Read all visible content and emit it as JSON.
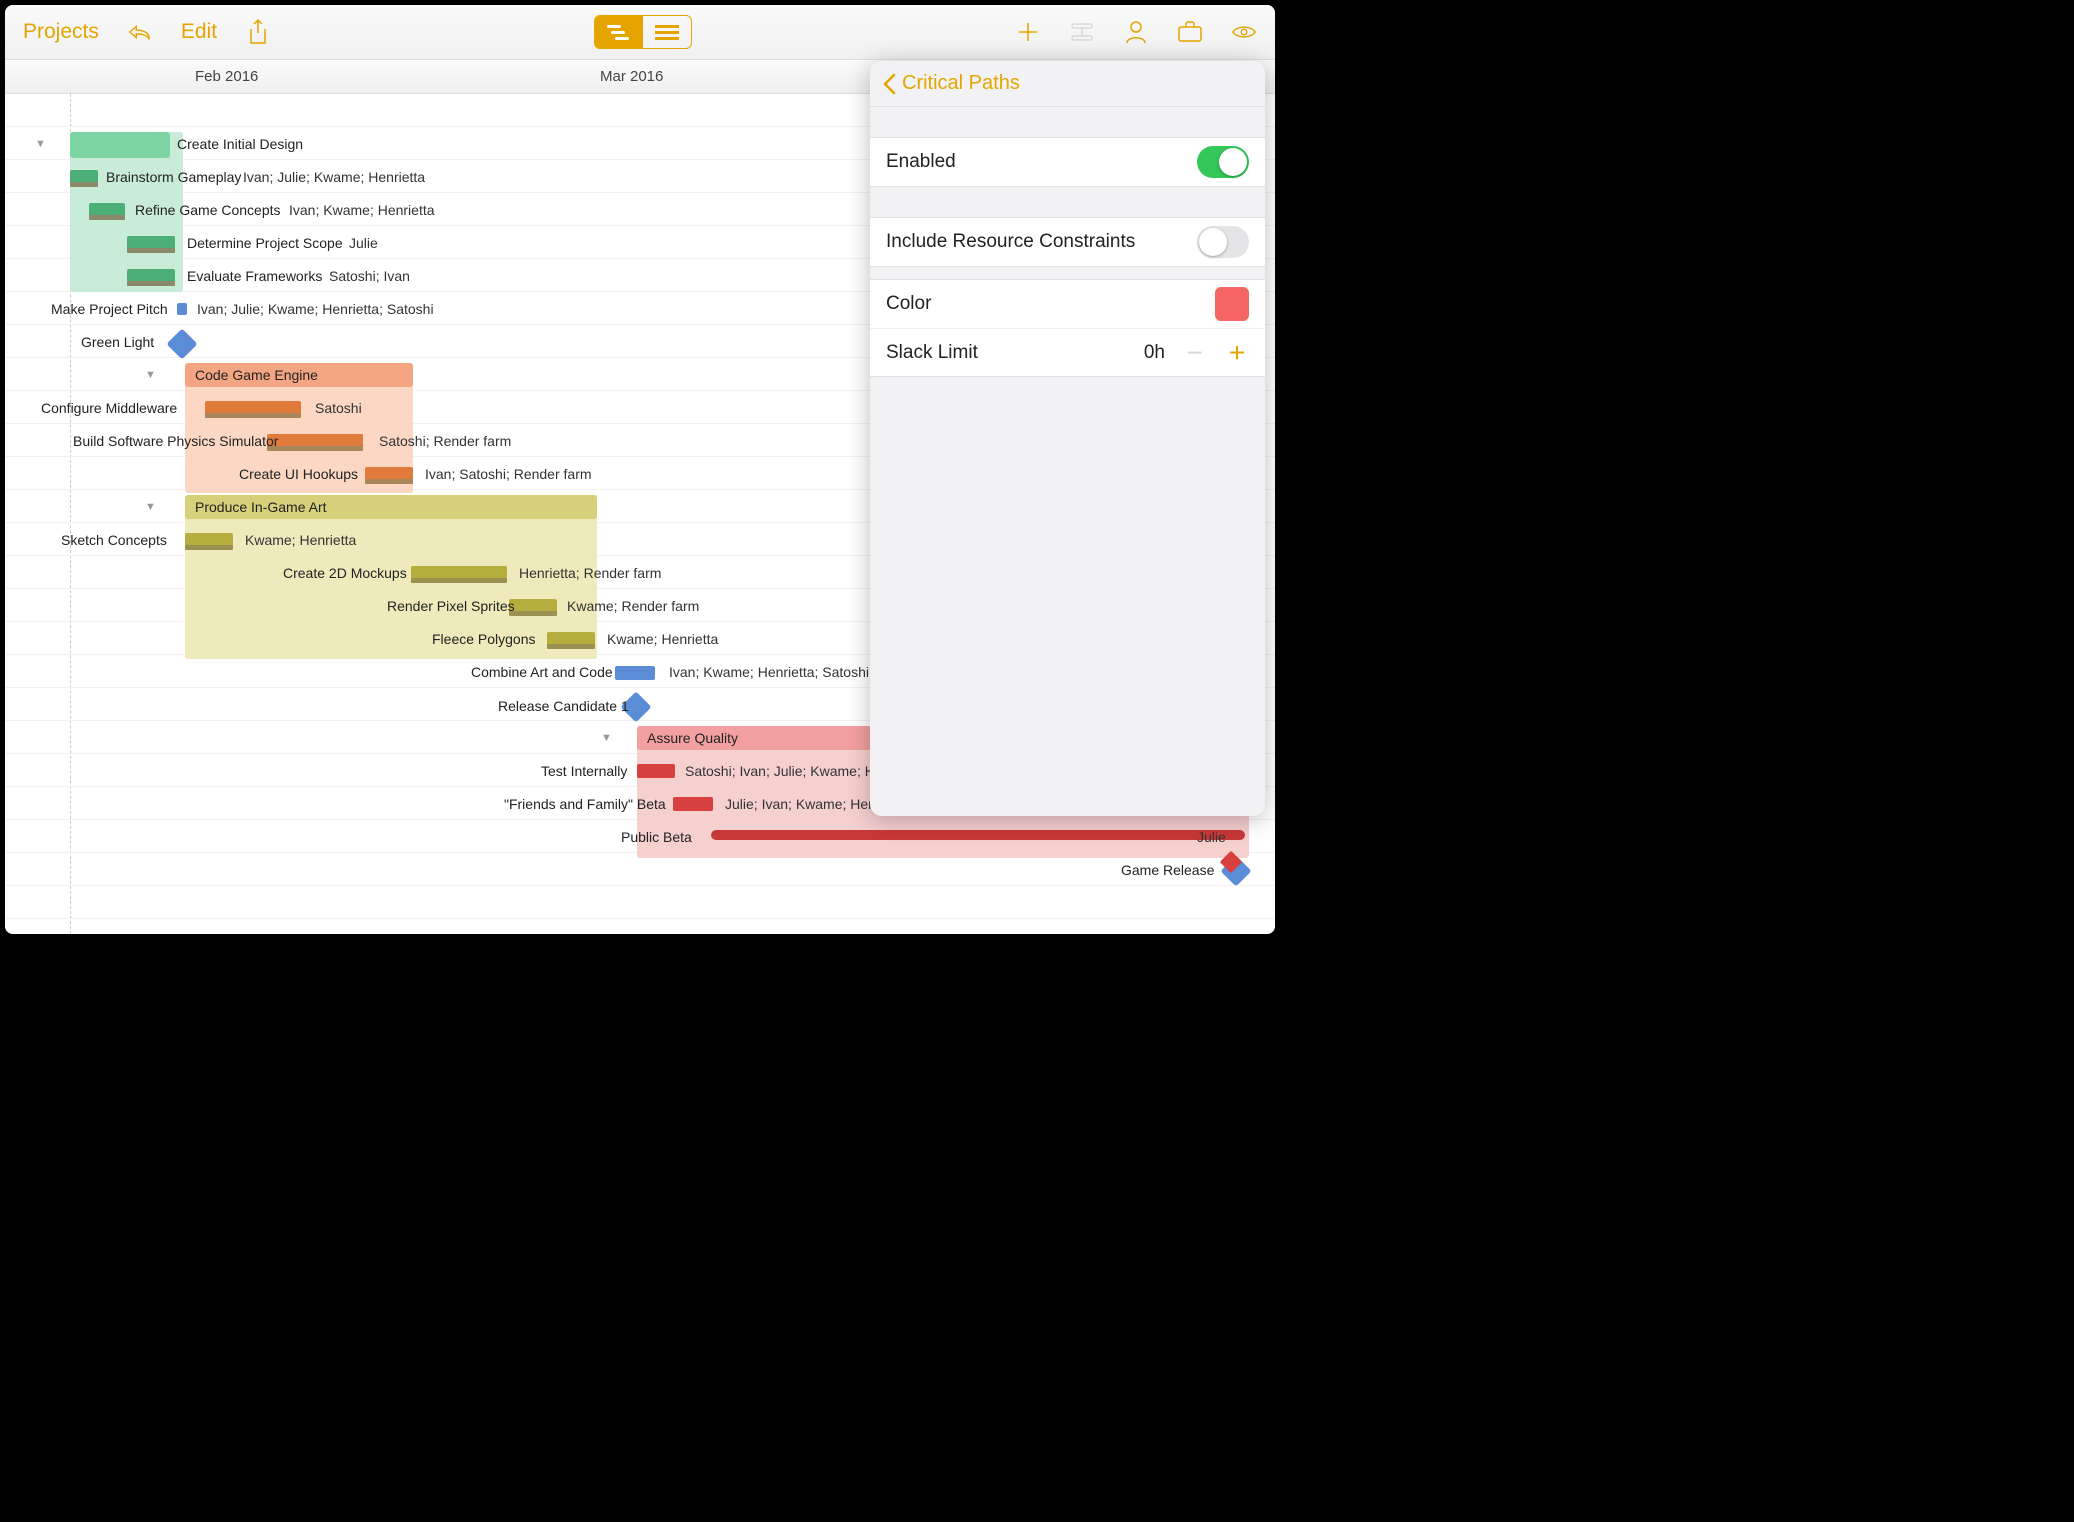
{
  "toolbar": {
    "projects": "Projects",
    "edit": "Edit"
  },
  "timeline": {
    "month1": "Feb 2016",
    "month2": "Mar 2016"
  },
  "popover": {
    "title": "Critical Paths",
    "enabled_label": "Enabled",
    "enabled": true,
    "include_resource_label": "Include Resource Constraints",
    "include_resource": false,
    "color_label": "Color",
    "color": "#f56565",
    "slack_label": "Slack Limit",
    "slack_value": "0h"
  },
  "tasks": [
    {
      "name": "Create Initial Design",
      "resources": "",
      "type": "group",
      "color": "#7dd4a3"
    },
    {
      "name": "Brainstorm Gameplay",
      "resources": "Ivan; Julie; Kwame; Henrietta",
      "color": "#4caf78"
    },
    {
      "name": "Refine Game Concepts",
      "resources": "Ivan; Kwame; Henrietta",
      "color": "#4caf78"
    },
    {
      "name": "Determine Project Scope",
      "resources": "Julie",
      "color": "#4caf78"
    },
    {
      "name": "Evaluate Frameworks",
      "resources": "Satoshi; Ivan",
      "color": "#4caf78"
    },
    {
      "name": "Make Project Pitch",
      "resources": "Ivan; Julie; Kwame; Henrietta; Satoshi",
      "color": "#5b8dd6"
    },
    {
      "name": "Green Light",
      "resources": "",
      "type": "milestone",
      "color": "#5b8dd6"
    },
    {
      "name": "Code Game Engine",
      "resources": "",
      "type": "group",
      "color": "#f4a582"
    },
    {
      "name": "Configure Middleware",
      "resources": "Satoshi",
      "color": "#e07b3c"
    },
    {
      "name": "Build Software Physics Simulator",
      "resources": "Satoshi; Render farm",
      "color": "#e07b3c"
    },
    {
      "name": "Create UI Hookups",
      "resources": "Ivan; Satoshi; Render farm",
      "color": "#e07b3c"
    },
    {
      "name": "Produce In-Game Art",
      "resources": "",
      "type": "group",
      "color": "#d6d07a"
    },
    {
      "name": "Sketch Concepts",
      "resources": "Kwame; Henrietta",
      "color": "#b5ad3e"
    },
    {
      "name": "Create 2D Mockups",
      "resources": "Henrietta; Render farm",
      "color": "#b5ad3e"
    },
    {
      "name": "Render Pixel Sprites",
      "resources": "Kwame; Render farm",
      "color": "#b5ad3e"
    },
    {
      "name": "Fleece Polygons",
      "resources": "Kwame; Henrietta",
      "color": "#b5ad3e"
    },
    {
      "name": "Combine Art and Code",
      "resources": "Ivan; Kwame; Henrietta; Satoshi; Render farm",
      "color": "#5b8dd6"
    },
    {
      "name": "Release Candidate 1",
      "resources": "",
      "type": "milestone",
      "color": "#5b8dd6"
    },
    {
      "name": "Assure Quality",
      "resources": "",
      "type": "group",
      "color": "#f2a0a0"
    },
    {
      "name": "Test Internally",
      "resources": "Satoshi; Ivan; Julie; Kwame; Henrietta",
      "color": "#d84040"
    },
    {
      "name": "\"Friends and Family\" Beta",
      "resources": "Julie; Ivan; Kwame; Henrietta; Satoshi",
      "color": "#d84040"
    },
    {
      "name": "Public Beta",
      "resources": "Julie",
      "color": "#d84040"
    },
    {
      "name": "Game Release",
      "resources": "",
      "type": "milestone",
      "color": "#5b8dd6"
    }
  ]
}
